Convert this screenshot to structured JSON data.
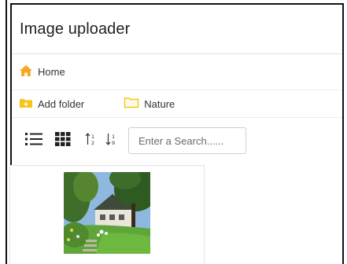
{
  "app": {
    "title": "Image uploader"
  },
  "breadcrumb": {
    "home_label": "Home",
    "home_icon": "home-icon"
  },
  "folders": {
    "add_folder_label": "Add folder",
    "items": [
      {
        "label": "Nature",
        "icon": "folder-outline-icon"
      }
    ]
  },
  "toolbar": {
    "list_view_icon": "list-view-icon",
    "grid_view_icon": "grid-view-icon",
    "sort_asc_icon": "sort-ascending-icon",
    "sort_desc_icon": "sort-descending-icon",
    "search_placeholder": "Enter a Search......"
  },
  "gallery": {
    "images": [
      {
        "subject": "house-with-garden-thumbnail"
      }
    ]
  },
  "colors": {
    "folder_yellow": "#f5c518",
    "home_orange": "#f5a623",
    "border": "#111111"
  }
}
